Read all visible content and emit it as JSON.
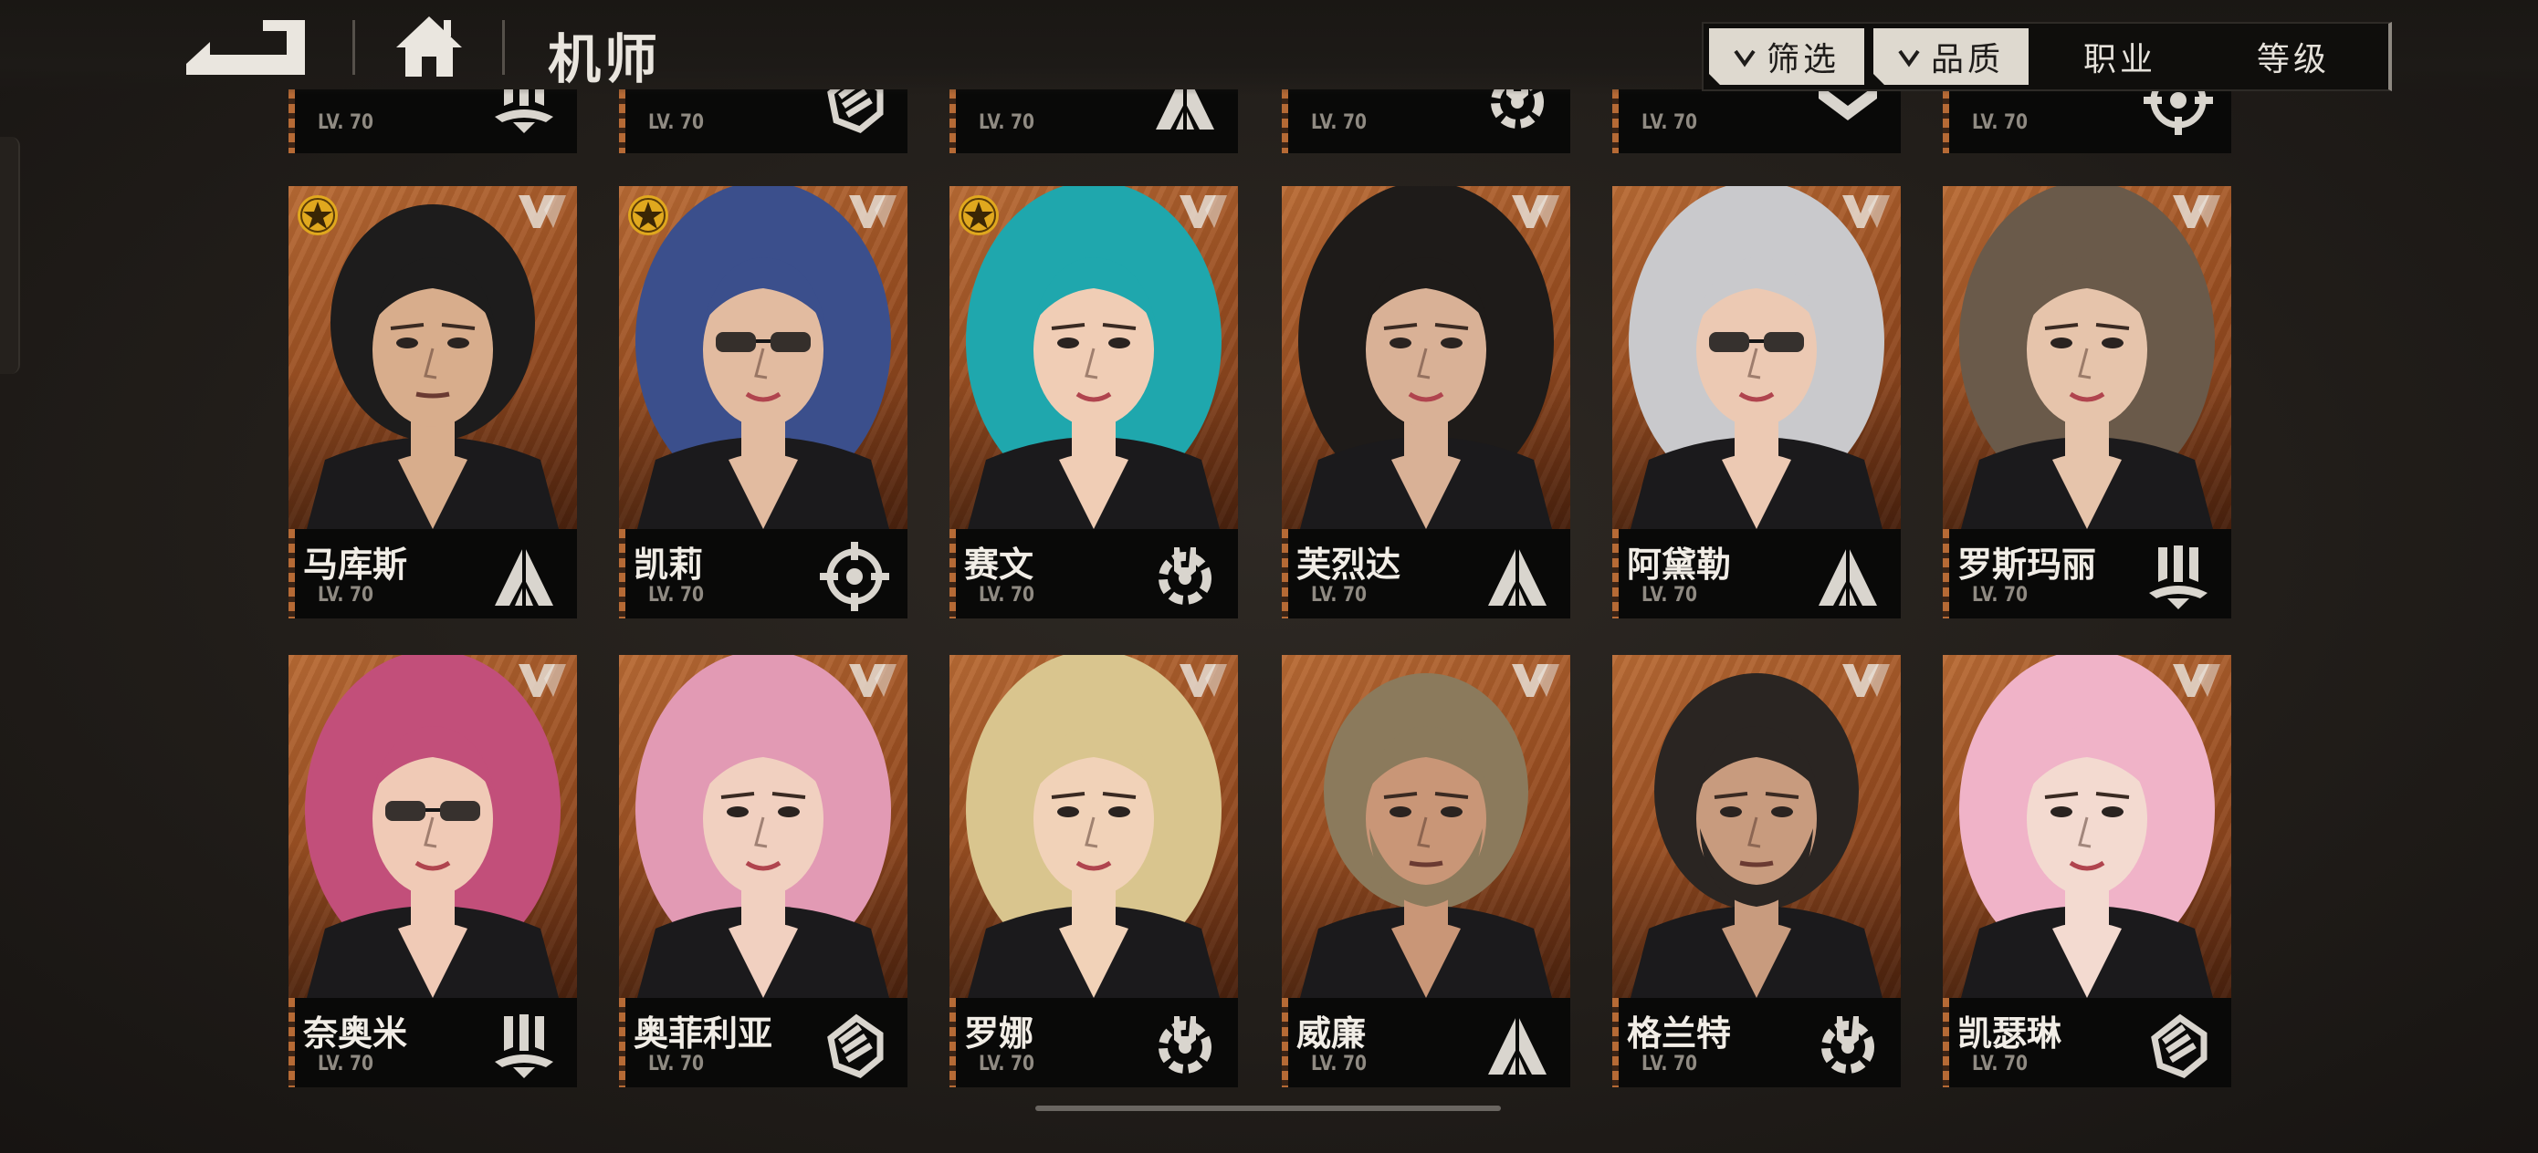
{
  "header": {
    "title": "机师",
    "back_icon": "back-arrow-icon",
    "home_icon": "home-icon"
  },
  "filters": [
    {
      "label": "筛选",
      "active": true,
      "icon": "chevron-down-icon"
    },
    {
      "label": "品质",
      "active": true,
      "icon": "chevron-down-icon"
    },
    {
      "label": "职业",
      "active": false
    },
    {
      "label": "等级",
      "active": false
    }
  ],
  "colors": {
    "card_bg": "#b86a34",
    "accent_gold": "#e0a81e",
    "text_light": "#f1ede6"
  },
  "partial_row": [
    {
      "level": "LV. 70",
      "class_icon": "claw-class-icon"
    },
    {
      "level": "LV. 70",
      "class_icon": "fist-class-icon"
    },
    {
      "level": "LV. 70",
      "class_icon": "arrow-class-icon"
    },
    {
      "level": "LV. 70",
      "class_icon": "wrench-class-icon"
    },
    {
      "level": "LV. 70",
      "class_icon": "chevron-class-icon"
    },
    {
      "level": "LV. 70",
      "class_icon": "target-class-icon"
    }
  ],
  "pilots": [
    {
      "name": "马库斯",
      "level": "LV. 70",
      "class_icon": "arrow-class-icon",
      "star": true,
      "hair": "#1d1c1c",
      "skin": "#d8ad8c"
    },
    {
      "name": "凯莉",
      "level": "LV. 70",
      "class_icon": "target-class-icon",
      "star": true,
      "hair": "#3b4f8c",
      "skin": "#e2bba0"
    },
    {
      "name": "赛文",
      "level": "LV. 70",
      "class_icon": "wrench-class-icon",
      "star": true,
      "hair": "#1fa7ad",
      "skin": "#f0cdb5"
    },
    {
      "name": "芙烈达",
      "level": "LV. 70",
      "class_icon": "arrow-class-icon",
      "star": false,
      "hair": "#1e1b19",
      "skin": "#d9b196"
    },
    {
      "name": "阿黛勒",
      "level": "LV. 70",
      "class_icon": "arrow-class-icon",
      "star": false,
      "hair": "#c9c9cc",
      "skin": "#ecc9b3"
    },
    {
      "name": "罗斯玛丽",
      "level": "LV. 70",
      "class_icon": "claw-class-icon",
      "star": false,
      "hair": "#6a5a4a",
      "skin": "#e6c4ab"
    },
    {
      "name": "奈奥米",
      "level": "LV. 70",
      "class_icon": "claw-class-icon",
      "star": false,
      "hair": "#c24f7a",
      "skin": "#f0cab6"
    },
    {
      "name": "奥菲利亚",
      "level": "LV. 70",
      "class_icon": "fist-class-icon",
      "star": false,
      "hair": "#e29ab4",
      "skin": "#f1d0c0"
    },
    {
      "name": "罗娜",
      "level": "LV. 70",
      "class_icon": "wrench-class-icon",
      "star": false,
      "hair": "#d9c58e",
      "skin": "#f1d2b8"
    },
    {
      "name": "威廉",
      "level": "LV. 70",
      "class_icon": "arrow-class-icon",
      "star": false,
      "hair": "#8b7a5c",
      "skin": "#c99677"
    },
    {
      "name": "格兰特",
      "level": "LV. 70",
      "class_icon": "wrench-class-icon",
      "star": false,
      "hair": "#2a2522",
      "skin": "#c89b7e"
    },
    {
      "name": "凯瑟琳",
      "level": "LV. 70",
      "class_icon": "fist-class-icon",
      "star": false,
      "hair": "#f0b3c8",
      "skin": "#f3dad0"
    }
  ]
}
